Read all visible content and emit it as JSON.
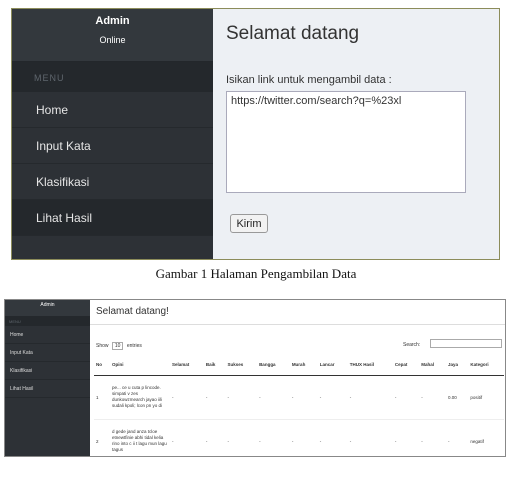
{
  "figure1": {
    "sidebar": {
      "username": "Admin",
      "status": "Online",
      "menu_heading": "MENU",
      "items": [
        {
          "label": "Home"
        },
        {
          "label": "Input Kata"
        },
        {
          "label": "Klasifikasi"
        },
        {
          "label": "Lihat Hasil"
        }
      ]
    },
    "main": {
      "title": "Selamat datang",
      "input_label": "Isikan link untuk mengambil data :",
      "link_value": "https://twitter.com/search?q=%23xl",
      "submit_label": "Kirim"
    }
  },
  "caption1": "Gambar 1 Halaman Pengambilan Data",
  "figure2": {
    "sidebar": {
      "username": "Admin",
      "menu_heading": "MENU",
      "items": [
        {
          "label": "Home"
        },
        {
          "label": "Input Kata"
        },
        {
          "label": "Klasifikasi"
        },
        {
          "label": "Lihat Hasil"
        }
      ]
    },
    "main": {
      "title": "Selamat datang!",
      "show_prefix": "Show",
      "show_value": "10",
      "show_suffix": "entries",
      "search_label": "Search:",
      "columns": [
        "No",
        "Opini",
        "Selamat",
        "Baik",
        "Sukses",
        "Bangga",
        "Murah",
        "Lancar",
        "THUX Hasil",
        "Cepat",
        "Mahal",
        "Jaya",
        "Kategori"
      ],
      "rows": [
        {
          "cells": [
            "1",
            "pe... ce u cuta p lincode. simpati v zes dunkowzmearch jayao iili sudali kpoli; lcon pn yo di",
            "-",
            "-",
            "-",
            "-",
            "-",
            "-",
            "-",
            "-",
            "-",
            "0.00",
            "positif"
          ]
        },
        {
          "cells": [
            "2",
            "d gede jand anza tcloe etnewtfinie abhi tidal kelia rino into c ii t lagu mun lagu tagus",
            "-",
            "-",
            "-",
            "-",
            "-",
            "-",
            "-",
            "-",
            "-",
            "-",
            "negatif"
          ]
        }
      ]
    }
  }
}
